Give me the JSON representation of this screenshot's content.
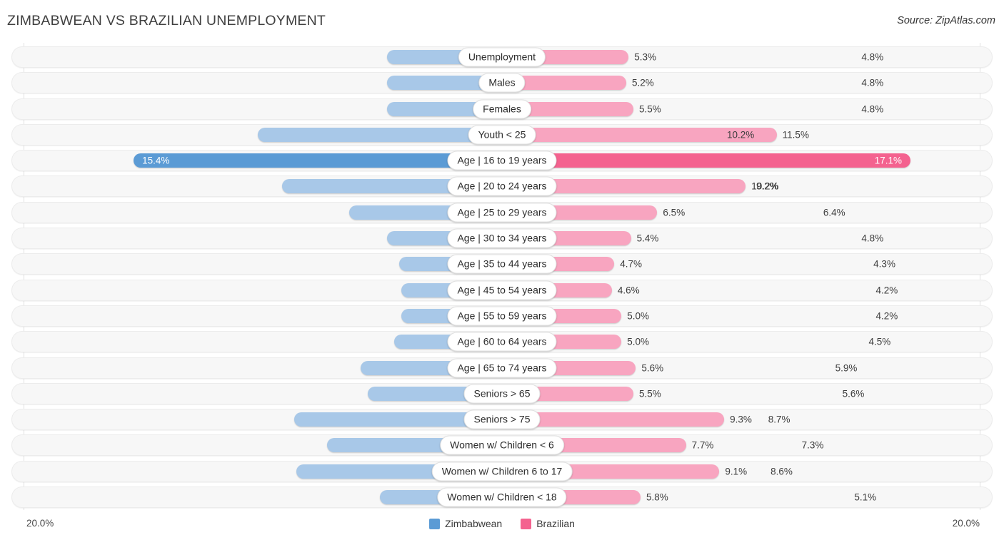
{
  "header": {
    "title": "ZIMBABWEAN VS BRAZILIAN UNEMPLOYMENT",
    "source": "Source: ZipAtlas.com"
  },
  "footer": {
    "axis_left": "20.0%",
    "axis_right": "20.0%",
    "legend": [
      {
        "label": "Zimbabwean",
        "color": "#5b9bd5"
      },
      {
        "label": "Brazilian",
        "color": "#f4628f"
      }
    ]
  },
  "colors": {
    "left_bar": "#a8c8e8",
    "right_bar": "#f8a5c0",
    "left_bar_highlight": "#5b9bd5",
    "right_bar_highlight": "#f4628f",
    "track": "#f7f7f7",
    "label_pill": "#ffffff"
  },
  "chart_data": {
    "type": "bar",
    "subtype": "diverging-bidirectional",
    "title": "ZIMBABWEAN VS BRAZILIAN UNEMPLOYMENT",
    "xlabel": "",
    "ylabel": "",
    "xlim": [
      0,
      20.0
    ],
    "axis_max_label": "20.0%",
    "grid": false,
    "legend_position": "bottom-center",
    "categories": [
      "Unemployment",
      "Males",
      "Females",
      "Youth < 25",
      "Age | 16 to 19 years",
      "Age | 20 to 24 years",
      "Age | 25 to 29 years",
      "Age | 30 to 34 years",
      "Age | 35 to 44 years",
      "Age | 45 to 54 years",
      "Age | 55 to 59 years",
      "Age | 60 to 64 years",
      "Age | 65 to 74 years",
      "Seniors > 65",
      "Seniors > 75",
      "Women w/ Children < 6",
      "Women w/ Children 6 to 17",
      "Women w/ Children < 18"
    ],
    "series": [
      {
        "name": "Zimbabwean",
        "side": "left",
        "color": "#a8c8e8",
        "values": [
          4.8,
          4.8,
          4.8,
          10.2,
          15.4,
          9.2,
          6.4,
          4.8,
          4.3,
          4.2,
          4.2,
          4.5,
          5.9,
          5.6,
          8.7,
          7.3,
          8.6,
          5.1
        ],
        "labels": [
          "4.8%",
          "4.8%",
          "4.8%",
          "10.2%",
          "15.4%",
          "9.2%",
          "6.4%",
          "4.8%",
          "4.3%",
          "4.2%",
          "4.2%",
          "4.5%",
          "5.9%",
          "5.6%",
          "8.7%",
          "7.3%",
          "8.6%",
          "5.1%"
        ]
      },
      {
        "name": "Brazilian",
        "side": "right",
        "color": "#f8a5c0",
        "values": [
          5.3,
          5.2,
          5.5,
          11.5,
          17.1,
          10.2,
          6.5,
          5.4,
          4.7,
          4.6,
          5.0,
          5.0,
          5.6,
          5.5,
          9.3,
          7.7,
          9.1,
          5.8
        ],
        "labels": [
          "5.3%",
          "5.2%",
          "5.5%",
          "11.5%",
          "17.1%",
          "10.2%",
          "6.5%",
          "5.4%",
          "4.7%",
          "4.6%",
          "5.0%",
          "5.0%",
          "5.6%",
          "5.5%",
          "9.3%",
          "7.7%",
          "9.1%",
          "5.8%"
        ]
      }
    ],
    "highlighted_row_index": 4
  },
  "rows": [
    {
      "label": "Unemployment",
      "left_value": 4.8,
      "left_label": "4.8%",
      "right_value": 5.3,
      "right_label": "5.3%",
      "highlight": false
    },
    {
      "label": "Males",
      "left_value": 4.8,
      "left_label": "4.8%",
      "right_value": 5.2,
      "right_label": "5.2%",
      "highlight": false
    },
    {
      "label": "Females",
      "left_value": 4.8,
      "left_label": "4.8%",
      "right_value": 5.5,
      "right_label": "5.5%",
      "highlight": false
    },
    {
      "label": "Youth < 25",
      "left_value": 10.2,
      "left_label": "10.2%",
      "right_value": 11.5,
      "right_label": "11.5%",
      "highlight": false
    },
    {
      "label": "Age | 16 to 19 years",
      "left_value": 15.4,
      "left_label": "15.4%",
      "right_value": 17.1,
      "right_label": "17.1%",
      "highlight": true
    },
    {
      "label": "Age | 20 to 24 years",
      "left_value": 9.2,
      "left_label": "9.2%",
      "right_value": 10.2,
      "right_label": "10.2%",
      "highlight": false
    },
    {
      "label": "Age | 25 to 29 years",
      "left_value": 6.4,
      "left_label": "6.4%",
      "right_value": 6.5,
      "right_label": "6.5%",
      "highlight": false
    },
    {
      "label": "Age | 30 to 34 years",
      "left_value": 4.8,
      "left_label": "4.8%",
      "right_value": 5.4,
      "right_label": "5.4%",
      "highlight": false
    },
    {
      "label": "Age | 35 to 44 years",
      "left_value": 4.3,
      "left_label": "4.3%",
      "right_value": 4.7,
      "right_label": "4.7%",
      "highlight": false
    },
    {
      "label": "Age | 45 to 54 years",
      "left_value": 4.2,
      "left_label": "4.2%",
      "right_value": 4.6,
      "right_label": "4.6%",
      "highlight": false
    },
    {
      "label": "Age | 55 to 59 years",
      "left_value": 4.2,
      "left_label": "4.2%",
      "right_value": 5.0,
      "right_label": "5.0%",
      "highlight": false
    },
    {
      "label": "Age | 60 to 64 years",
      "left_value": 4.5,
      "left_label": "4.5%",
      "right_value": 5.0,
      "right_label": "5.0%",
      "highlight": false
    },
    {
      "label": "Age | 65 to 74 years",
      "left_value": 5.9,
      "left_label": "5.9%",
      "right_value": 5.6,
      "right_label": "5.6%",
      "highlight": false
    },
    {
      "label": "Seniors > 65",
      "left_value": 5.6,
      "left_label": "5.6%",
      "right_value": 5.5,
      "right_label": "5.5%",
      "highlight": false
    },
    {
      "label": "Seniors > 75",
      "left_value": 8.7,
      "left_label": "8.7%",
      "right_value": 9.3,
      "right_label": "9.3%",
      "highlight": false
    },
    {
      "label": "Women w/ Children < 6",
      "left_value": 7.3,
      "left_label": "7.3%",
      "right_value": 7.7,
      "right_label": "7.7%",
      "highlight": false
    },
    {
      "label": "Women w/ Children 6 to 17",
      "left_value": 8.6,
      "left_label": "8.6%",
      "right_value": 9.1,
      "right_label": "9.1%",
      "highlight": false
    },
    {
      "label": "Women w/ Children < 18",
      "left_value": 5.1,
      "left_label": "5.1%",
      "right_value": 5.8,
      "right_label": "5.8%",
      "highlight": false
    }
  ]
}
